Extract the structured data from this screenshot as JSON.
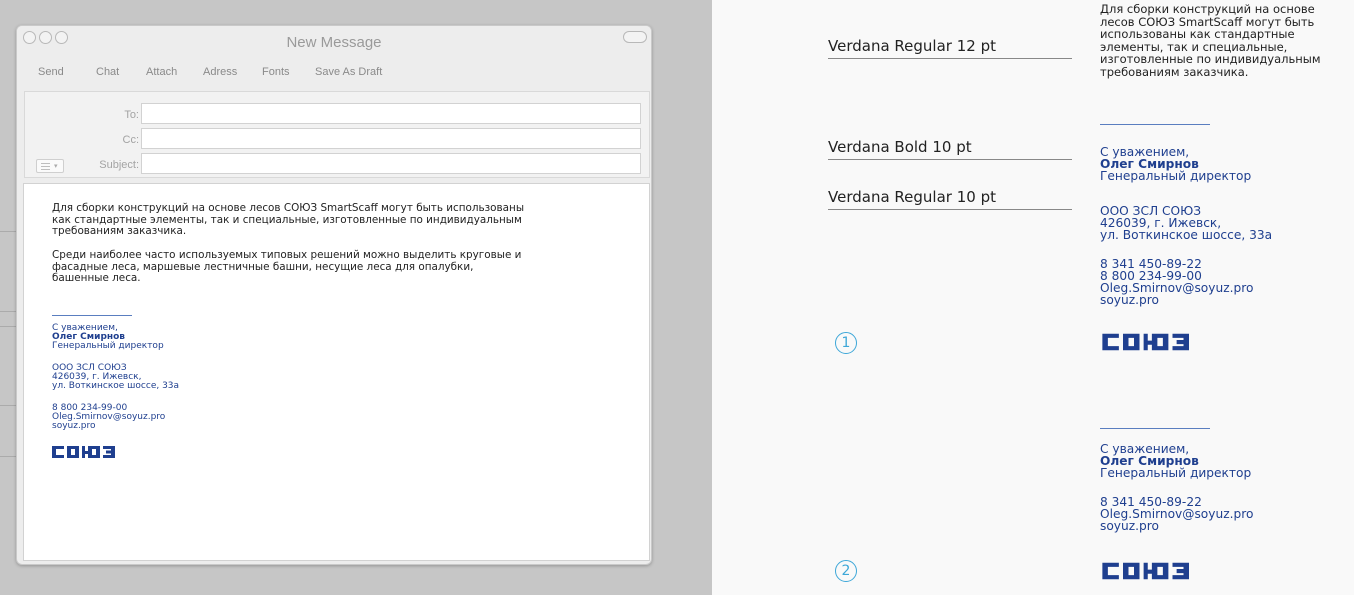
{
  "window": {
    "title": "New Message",
    "toolbar": [
      "Send",
      "Chat",
      "Attach",
      "Adress",
      "Fonts",
      "Save As Draft"
    ],
    "fields": [
      {
        "label": "To:",
        "value": ""
      },
      {
        "label": "Cc:",
        "value": ""
      },
      {
        "label": "Subject:",
        "value": ""
      }
    ]
  },
  "message": {
    "paragraph1": "Для сборки конструкций на основе лесов СОЮЗ SmartScaff могут быть использованы как стандартные элементы, так и специальные, изготовленные по индивидуальным требованиям заказчика.",
    "paragraph2": "Среди наиболее часто используемых типовых решений можно выделить круговые и фасадные леса, маршевые лестничные башни, несущие леса для опалубки, башенные леса."
  },
  "signature": {
    "greeting": "С уважением,",
    "name": "Олег Смирнов",
    "position": "Генеральный директор",
    "company": "ООО ЗСЛ СОЮЗ",
    "address1": "426039, г. Ижевск,",
    "address2": "ул. Воткинское шоссе, 33а",
    "phone1": "8 341 450-89-22",
    "phone2": "8 800 234-99-00",
    "email": "Oleg.Smirnov@soyuz.pro",
    "site": "soyuz.pro",
    "logo_text": "СОЮЗ"
  },
  "specs": {
    "regular12": "Verdana Regular 12 pt",
    "bold10": "Verdana Bold 10 pt",
    "regular10": "Verdana Regular 10 pt"
  },
  "right_body": "Для сборки конструкций на основе лесов СОЮЗ SmartScaff могут быть использованы как стандартные элементы, так и специальные, изготовленные по индивидуальным требованиям заказчика.",
  "variants": [
    "1",
    "2"
  ],
  "colors": {
    "brand_blue": "#1f3f8f",
    "accent_cyan": "#3da7d8"
  }
}
